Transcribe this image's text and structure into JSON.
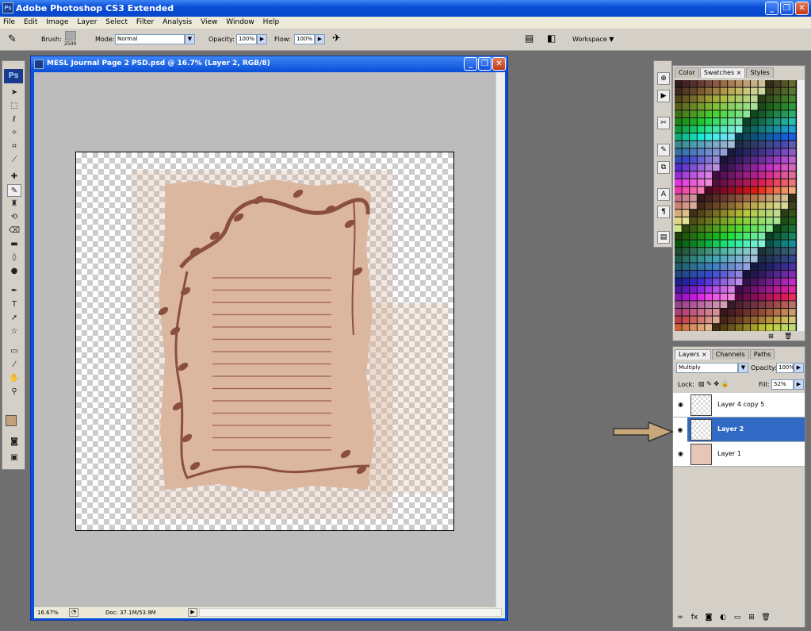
{
  "app": {
    "title": "Adobe Photoshop CS3 Extended",
    "icon": "Ps"
  },
  "menu": [
    "File",
    "Edit",
    "Image",
    "Layer",
    "Select",
    "Filter",
    "Analysis",
    "View",
    "Window",
    "Help"
  ],
  "options": {
    "brush_label": "Brush:",
    "brush_size": "2500",
    "mode_label": "Mode:",
    "mode_value": "Normal",
    "opacity_label": "Opacity:",
    "opacity_value": "100%",
    "flow_label": "Flow:",
    "flow_value": "100%",
    "workspace_label": "Workspace ▼"
  },
  "toolbox": {
    "logo": "Ps"
  },
  "document": {
    "title": "MESL Journal Page 2 PSD.psd @ 16.7% (Layer 2, RGB/8)",
    "zoom": "16.67%",
    "doc_info": "Doc: 37.1M/53.9M"
  },
  "swatch_tabs": [
    "Color",
    "Swatches ×",
    "Styles"
  ],
  "layer_tabs": [
    "Layers ×",
    "Channels",
    "Paths"
  ],
  "layers_panel": {
    "blend_mode": "Multiply",
    "opacity_label": "Opacity:",
    "opacity_value": "100%",
    "lock_label": "Lock:",
    "fill_label": "Fill:",
    "fill_value": "52%"
  },
  "layers": [
    {
      "name": "Layer 4 copy 5",
      "selected": false
    },
    {
      "name": "Layer 2",
      "selected": true
    },
    {
      "name": "Layer 1",
      "selected": false
    }
  ],
  "colors": {
    "page_fill": "#dcb7a0",
    "vine": "#8b4f40",
    "line": "#a0604f",
    "selection": "#316ac5"
  }
}
